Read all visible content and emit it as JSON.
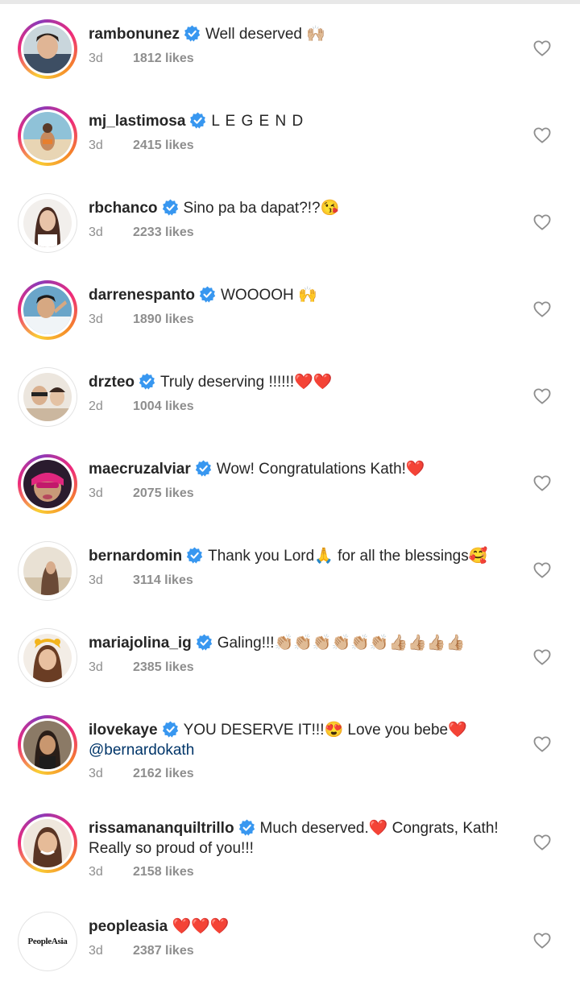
{
  "comments": [
    {
      "user": "rambonunez",
      "text": "Well deserved 🙌🏼",
      "time": "3d",
      "likes": "1812 likes"
    },
    {
      "user": "mj_lastimosa",
      "text": "L E G E N D",
      "time": "3d",
      "likes": "2415 likes"
    },
    {
      "user": "rbchanco",
      "text": "Sino pa ba dapat?!?😘",
      "time": "3d",
      "likes": "2233 likes"
    },
    {
      "user": "darrenespanto",
      "text": "WOOOOH 🙌",
      "time": "3d",
      "likes": "1890 likes"
    },
    {
      "user": "drzteo",
      "text": "Truly deserving !!!!!!❤️❤️",
      "time": "2d",
      "likes": "1004 likes"
    },
    {
      "user": "maecruzalviar",
      "text": "Wow! Congratulations Kath!❤️",
      "time": "3d",
      "likes": "2075 likes"
    },
    {
      "user": "bernardomin",
      "text": "Thank you Lord🙏 for all the blessings🥰",
      "time": "3d",
      "likes": "3114 likes"
    },
    {
      "user": "mariajolina_ig",
      "text": "Galing!!!👏🏼👏🏼👏🏼👏🏼👏🏼👏🏼👍🏼👍🏼👍🏼👍🏼",
      "time": "3d",
      "likes": "2385 likes"
    },
    {
      "user": "ilovekaye",
      "text": "YOU DESERVE IT!!!😍 Love you bebe❤️",
      "mention": "@bernardokath",
      "time": "3d",
      "likes": "2162 likes"
    },
    {
      "user": "rissamananquiltrillo",
      "text": "Much deserved.❤️ Congrats, Kath! Really so proud of you!!!",
      "time": "3d",
      "likes": "2158 likes"
    },
    {
      "user": "peopleasia",
      "text": "❤️❤️❤️",
      "time": "3d",
      "likes": "2387 likes",
      "logo": "PeopleAsia"
    }
  ]
}
